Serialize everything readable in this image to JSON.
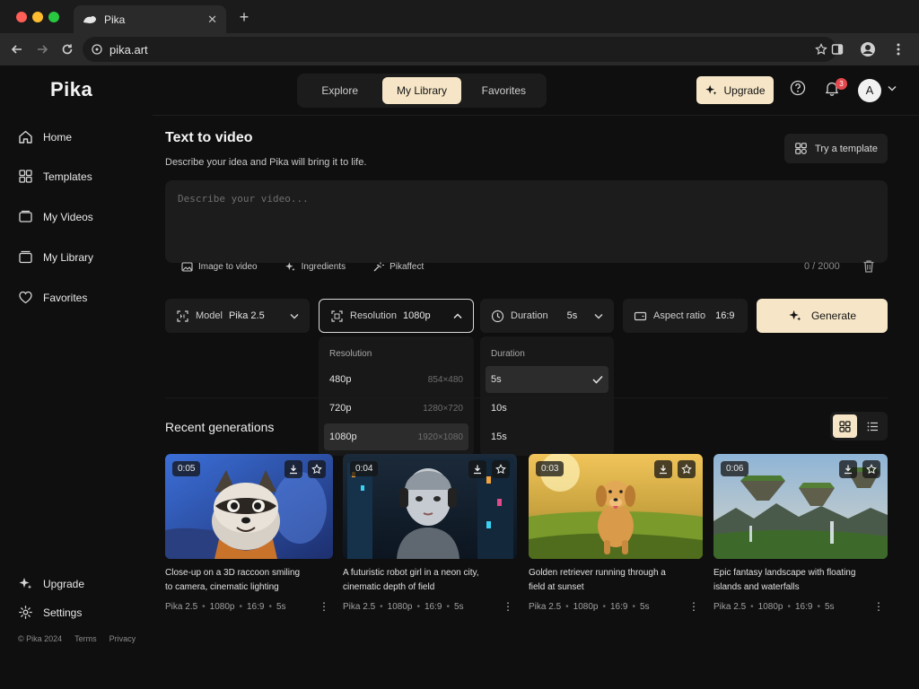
{
  "browser": {
    "tab_title": "Pika",
    "url": "pika.art"
  },
  "app": {
    "logo": "Pika",
    "sidebar": {
      "items": [
        {
          "label": "Home",
          "icon": "home-icon"
        },
        {
          "label": "Templates",
          "icon": "grid-icon"
        },
        {
          "label": "My Videos",
          "icon": "video-icon"
        },
        {
          "label": "My Library",
          "icon": "library-icon"
        },
        {
          "label": "Favorites",
          "icon": "heart-icon"
        }
      ],
      "bottom_items": [
        {
          "label": "Upgrade",
          "icon": "sparkle-icon"
        },
        {
          "label": "Settings",
          "icon": "gear-icon"
        }
      ],
      "footer": {
        "copyright": "© Pika 2024",
        "terms": "Terms",
        "privacy": "Privacy"
      }
    },
    "nav_tabs": [
      {
        "label": "Explore",
        "active": false
      },
      {
        "label": "My Library",
        "active": true
      },
      {
        "label": "Favorites",
        "active": false
      }
    ],
    "header": {
      "upgrade_label": "Upgrade",
      "notification_count": "3",
      "avatar_letter": "A"
    },
    "create": {
      "title": "Text to video",
      "subtitle": "Describe your idea and Pika will bring it to life.",
      "try_template_label": "Try a template",
      "placeholder": "Describe your video...",
      "tools": [
        {
          "label": "Image to video",
          "icon": "image-icon"
        },
        {
          "label": "Ingredients",
          "icon": "sparkle-icon"
        },
        {
          "label": "Pikaffect",
          "icon": "wand-icon"
        }
      ],
      "char_count": "0 / 2000"
    },
    "controls": {
      "model": {
        "label": "Model",
        "value": "Pika 2.5"
      },
      "resolution": {
        "label": "Resolution",
        "value": "1080p"
      },
      "duration": {
        "label": "Duration",
        "value": "5s"
      },
      "aspect_ratio": {
        "label": "Aspect ratio",
        "value": "16:9"
      },
      "generate_label": "Generate"
    },
    "resolution_menu": {
      "heading": "Resolution",
      "options": [
        {
          "label": "480p",
          "detail": "854×480",
          "selected": false
        },
        {
          "label": "720p",
          "detail": "1280×720",
          "selected": false
        },
        {
          "label": "1080p",
          "detail": "1920×1080",
          "selected": true
        }
      ]
    },
    "duration_menu": {
      "heading": "Duration",
      "options": [
        {
          "label": "5s",
          "selected": true
        },
        {
          "label": "10s",
          "selected": false
        },
        {
          "label": "15s",
          "selected": false
        }
      ]
    },
    "recent": {
      "title": "Recent generations",
      "cards": [
        {
          "duration": "0:05",
          "desc_line1": "Close-up on a 3D raccoon smiling",
          "desc_line2": "to camera, cinematic lighting",
          "model": "Pika 2.5",
          "res": "1080p",
          "ratio": "16:9",
          "len": "5s"
        },
        {
          "duration": "0:04",
          "desc_line1": "A futuristic robot girl in a neon city,",
          "desc_line2": "cinematic depth of field",
          "model": "Pika 2.5",
          "res": "1080p",
          "ratio": "16:9",
          "len": "5s"
        },
        {
          "duration": "0:03",
          "desc_line1": "Golden retriever running through a",
          "desc_line2": "field at sunset",
          "model": "Pika 2.5",
          "res": "1080p",
          "ratio": "16:9",
          "len": "5s"
        },
        {
          "duration": "0:06",
          "desc_line1": "Epic fantasy landscape with floating",
          "desc_line2": "islands and waterfalls",
          "model": "Pika 2.5",
          "res": "1080p",
          "ratio": "16:9",
          "len": "5s"
        }
      ]
    },
    "colors": {
      "accent": "#f6e6c7",
      "background": "#0f0f0f",
      "panel": "#1c1c1c",
      "badge": "#e5484d"
    }
  }
}
